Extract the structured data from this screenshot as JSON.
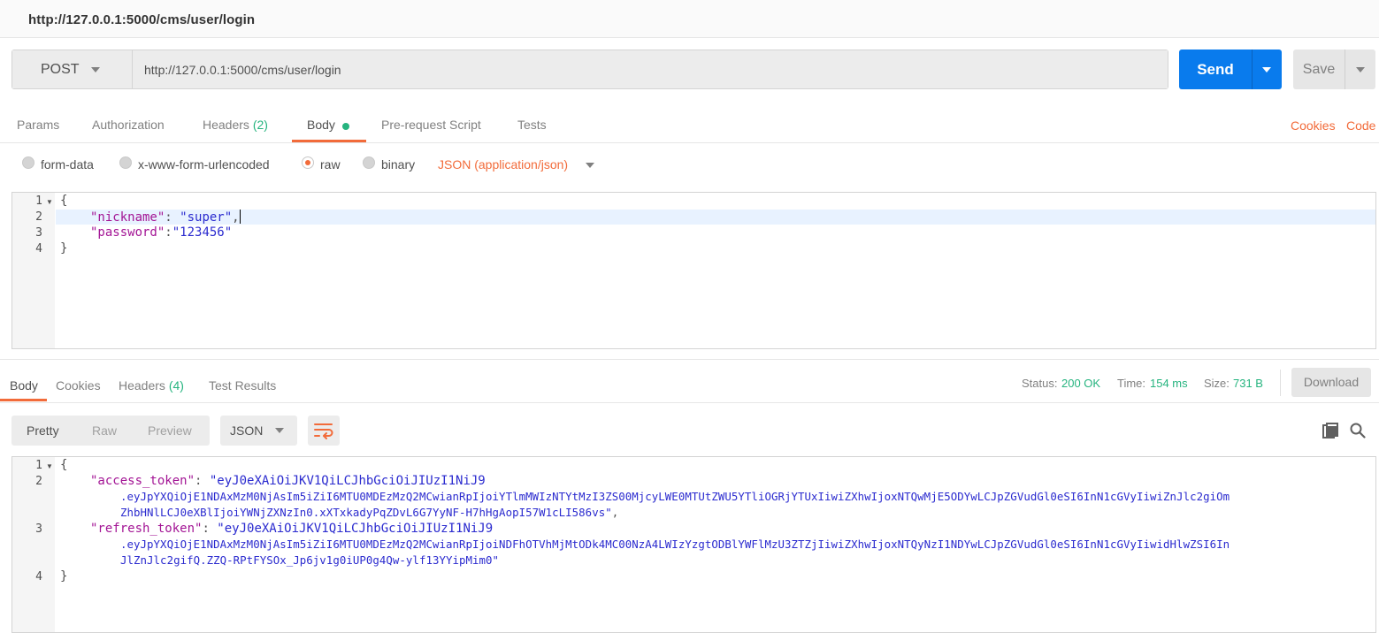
{
  "title_bar": {
    "title": "http://127.0.0.1:5000/cms/user/login"
  },
  "request": {
    "method": "POST",
    "url": "http://127.0.0.1:5000/cms/user/login",
    "send_label": "Send",
    "save_label": "Save"
  },
  "request_tabs": [
    {
      "label": "Params"
    },
    {
      "label": "Authorization"
    },
    {
      "label": "Headers",
      "count": "(2)"
    },
    {
      "label": "Body"
    },
    {
      "label": "Pre-request Script"
    },
    {
      "label": "Tests"
    }
  ],
  "request_links": {
    "cookies": "Cookies",
    "code": "Code"
  },
  "body_types": [
    "form-data",
    "x-www-form-urlencoded",
    "raw",
    "binary"
  ],
  "body_type_selected": "raw",
  "content_type": "JSON (application/json)",
  "request_body": {
    "line_numbers": [
      "1",
      "2",
      "3",
      "4"
    ],
    "open_brace": "{",
    "close_brace": "}",
    "k1": "\"nickname\"",
    "sep1": ": ",
    "v1": "\"super\"",
    "c1": ",",
    "k2": "\"password\"",
    "sep2": ":",
    "v2": "\"123456\""
  },
  "response_tabs": [
    {
      "label": "Body"
    },
    {
      "label": "Cookies"
    },
    {
      "label": "Headers",
      "count": "(4)"
    },
    {
      "label": "Test Results"
    }
  ],
  "response_meta": {
    "status_label": "Status:",
    "status": "200 OK",
    "time_label": "Time:",
    "time": "154 ms",
    "size_label": "Size:",
    "size": "731 B",
    "download_label": "Download"
  },
  "view_modes": [
    "Pretty",
    "Raw",
    "Preview"
  ],
  "view_selected": "Pretty",
  "format": "JSON",
  "response_body": {
    "line_numbers": [
      "1",
      "2",
      "3",
      "4"
    ],
    "open_brace": "{",
    "close_brace": "}",
    "k1": "\"access_token\"",
    "sep": ": ",
    "v1_a": "\"eyJ0eXAiOiJKV1QiLCJhbGciOiJIUzI1NiJ9",
    "v1_b": ".eyJpYXQiOjE1NDAxMzM0NjAsIm5iZiI6MTU0MDEzMzQ2MCwianRpIjoiYTlmMWIzNTYtMzI3ZS00MjcyLWE0MTUtZWU5YTliOGRjYTUxIiwiZXhwIjoxNTQwMjE5ODYwLCJpZGVudGl0eSI6InN1cGVyIiwiZnJlc2giOm",
    "v1_c": "ZhbHNlLCJ0eXBlIjoiYWNjZXNzIn0.xXTxkadyPqZDvL6G7YyNF-H7hHgAopI57W1cLI586vs\"",
    "k2": "\"refresh_token\"",
    "v2_a": "\"eyJ0eXAiOiJKV1QiLCJhbGciOiJIUzI1NiJ9",
    "v2_b": ".eyJpYXQiOjE1NDAxMzM0NjAsIm5iZiI6MTU0MDEzMzQ2MCwianRpIjoiNDFhOTVhMjMtODk4MC00NzA4LWIzYzgtODBlYWFlMzU3ZTZjIiwiZXhwIjoxNTQyNzI1NDYwLCJpZGVudGl0eSI6InN1cGVyIiwidHlwZSI6In",
    "v2_c": "JlZnJlc2gifQ.ZZQ-RPtFYSOx_Jp6jv1g0iUP0g4Qw-ylf13YYipMim0\"",
    "comma": ","
  },
  "icons": {
    "method_caret": "chevron-down-icon",
    "send_caret": "chevron-down-icon",
    "save_caret": "chevron-down-icon",
    "wrap": "wrap-lines-icon",
    "copy": "copy-icon",
    "search": "search-icon"
  },
  "colors": {
    "accent_orange": "#f26b3a",
    "send_blue": "#097bed",
    "success_green": "#26b47f",
    "json_key": "#a31595",
    "json_string": "#2b2bcf"
  }
}
